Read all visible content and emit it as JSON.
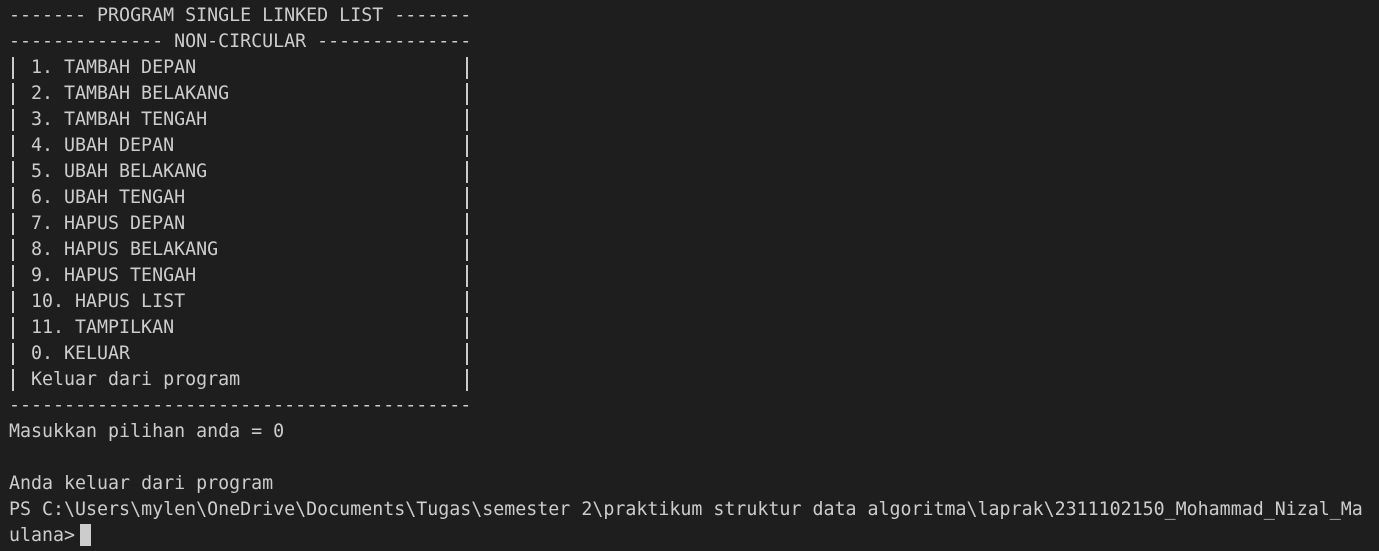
{
  "header": {
    "title_line": "------- PROGRAM SINGLE LINKED LIST -------",
    "subtitle_line": "-------------- NON-CIRCULAR --------------"
  },
  "menu": {
    "items": [
      "1. TAMBAH DEPAN",
      "2. TAMBAH BELAKANG",
      "3. TAMBAH TENGAH",
      "4. UBAH DEPAN",
      "5. UBAH BELAKANG",
      "6. UBAH TENGAH",
      "7. HAPUS DEPAN",
      "8. HAPUS BELAKANG",
      "9. HAPUS TENGAH",
      "10. HAPUS LIST",
      "11. TAMPILKAN",
      "0. KELUAR",
      "Keluar dari program"
    ],
    "bottom_line": "------------------------------------------"
  },
  "output": {
    "prompt_input": "Masukkan pilihan anda = 0",
    "exit_message": "Anda keluar dari program",
    "ps_prompt_line1": "PS C:\\Users\\mylen\\OneDrive\\Documents\\Tugas\\semester 2\\praktikum struktur data algoritma\\laprak\\2311102150_Mohammad_Nizal_Ma",
    "ps_prompt_line2": "ulana>"
  },
  "colors": {
    "background": "#1e1e1e",
    "text": "#cccccc"
  }
}
